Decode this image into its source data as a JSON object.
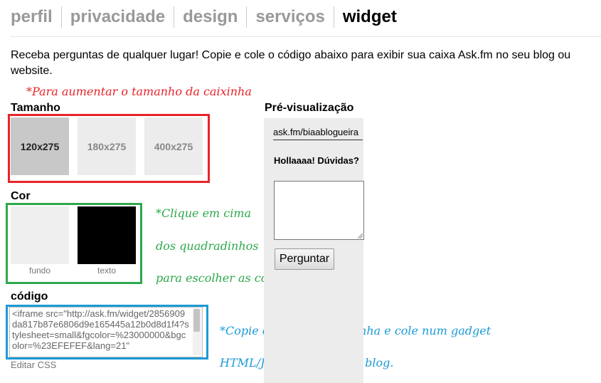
{
  "tabs": [
    {
      "label": "perfil",
      "active": false
    },
    {
      "label": "privacidade",
      "active": false
    },
    {
      "label": "design",
      "active": false
    },
    {
      "label": "serviços",
      "active": false
    },
    {
      "label": "widget",
      "active": true
    }
  ],
  "intro": "Receba perguntas de qualquer lugar! Copie e cole o código abaixo para exibir sua caixa Ask.fm no seu blog ou website.",
  "annotations": {
    "size_note": "*Para aumentar o tamanho da caixinha",
    "color_note_1": "*Clique em cima",
    "color_note_2": "dos quadradinhos",
    "color_note_3": "para escolher as cores.",
    "code_note_1": "*Copie o código da caixinha e cole num gadget",
    "code_note_2": "HTML/JavaScript no seu blog.",
    "colors": {
      "red": "#e8232a",
      "green": "#2ea84c",
      "blue": "#1c9ad6"
    }
  },
  "size": {
    "label": "Tamanho",
    "options": [
      {
        "label": "120x275",
        "selected": true
      },
      {
        "label": "180x275",
        "selected": false
      },
      {
        "label": "400x275",
        "selected": false
      }
    ]
  },
  "color": {
    "label": "Cor",
    "background": {
      "caption": "fundo",
      "value": "#efefef"
    },
    "text": {
      "caption": "texto",
      "value": "#000000"
    }
  },
  "code": {
    "label": "código",
    "value": "<iframe src=\"http://ask.fm/widget/2856909da817b87e6806d9e165445a12b0d8d1f4?stylesheet=small&fgcolor=%23000000&bgcolor=%23EFEFEF&lang=21\"",
    "edit_css": "Editar CSS"
  },
  "preview": {
    "label": "Pré-visualização",
    "username": "ask.fm/biaablogueira",
    "question": "Hollaaaa! Dúvidas?",
    "button": "Perguntar"
  }
}
